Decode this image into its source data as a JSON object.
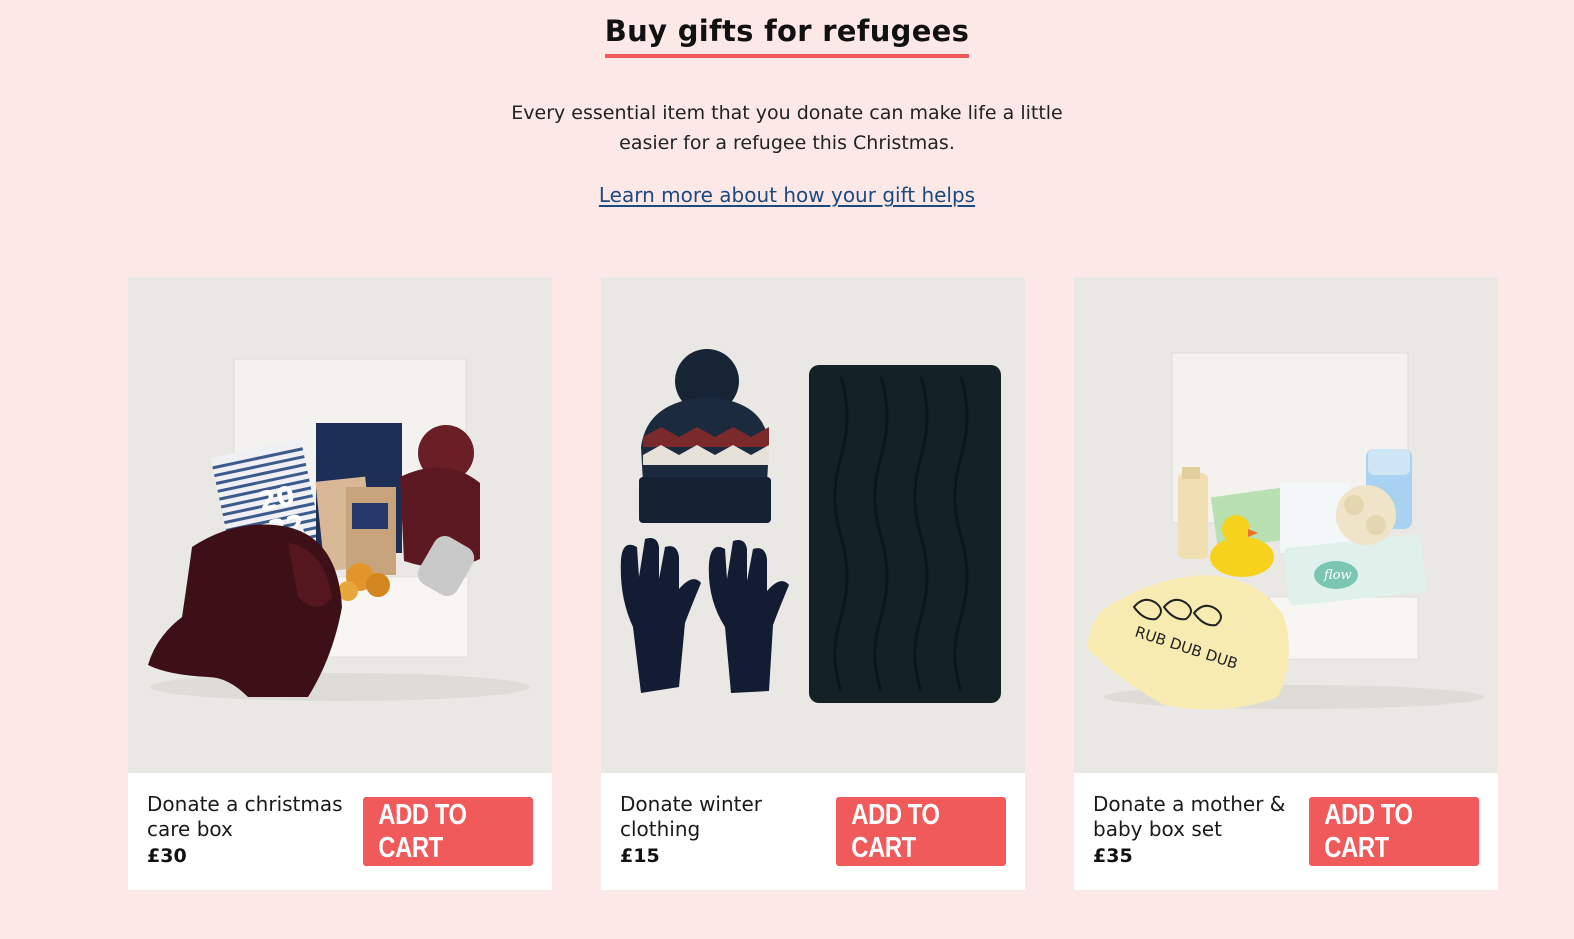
{
  "header": {
    "title": "Buy gifts for refugees",
    "intro": "Every essential item that you donate can make life a little easier for a refugee this Christmas.",
    "learn_more": "Learn more about how your gift helps"
  },
  "products": [
    {
      "name": "Donate a christmas care box",
      "price": "£30",
      "button": "ADD TO CART",
      "image": "christmas-care-box-image"
    },
    {
      "name": "Donate winter clothing",
      "price": "£15",
      "button": "ADD TO CART",
      "image": "winter-clothing-image"
    },
    {
      "name": "Donate a mother & baby box set",
      "price": "£35",
      "button": "ADD TO CART",
      "image": "mother-baby-box-image"
    }
  ],
  "photo_text": {
    "calendar_top": "20",
    "calendar_bottom": "22",
    "towel_print": "RUB DUB DUB",
    "wipes_brand": "flow"
  },
  "colors": {
    "background": "#fde8e8",
    "accent": "#f05a5b",
    "link": "#1d4a7e"
  }
}
